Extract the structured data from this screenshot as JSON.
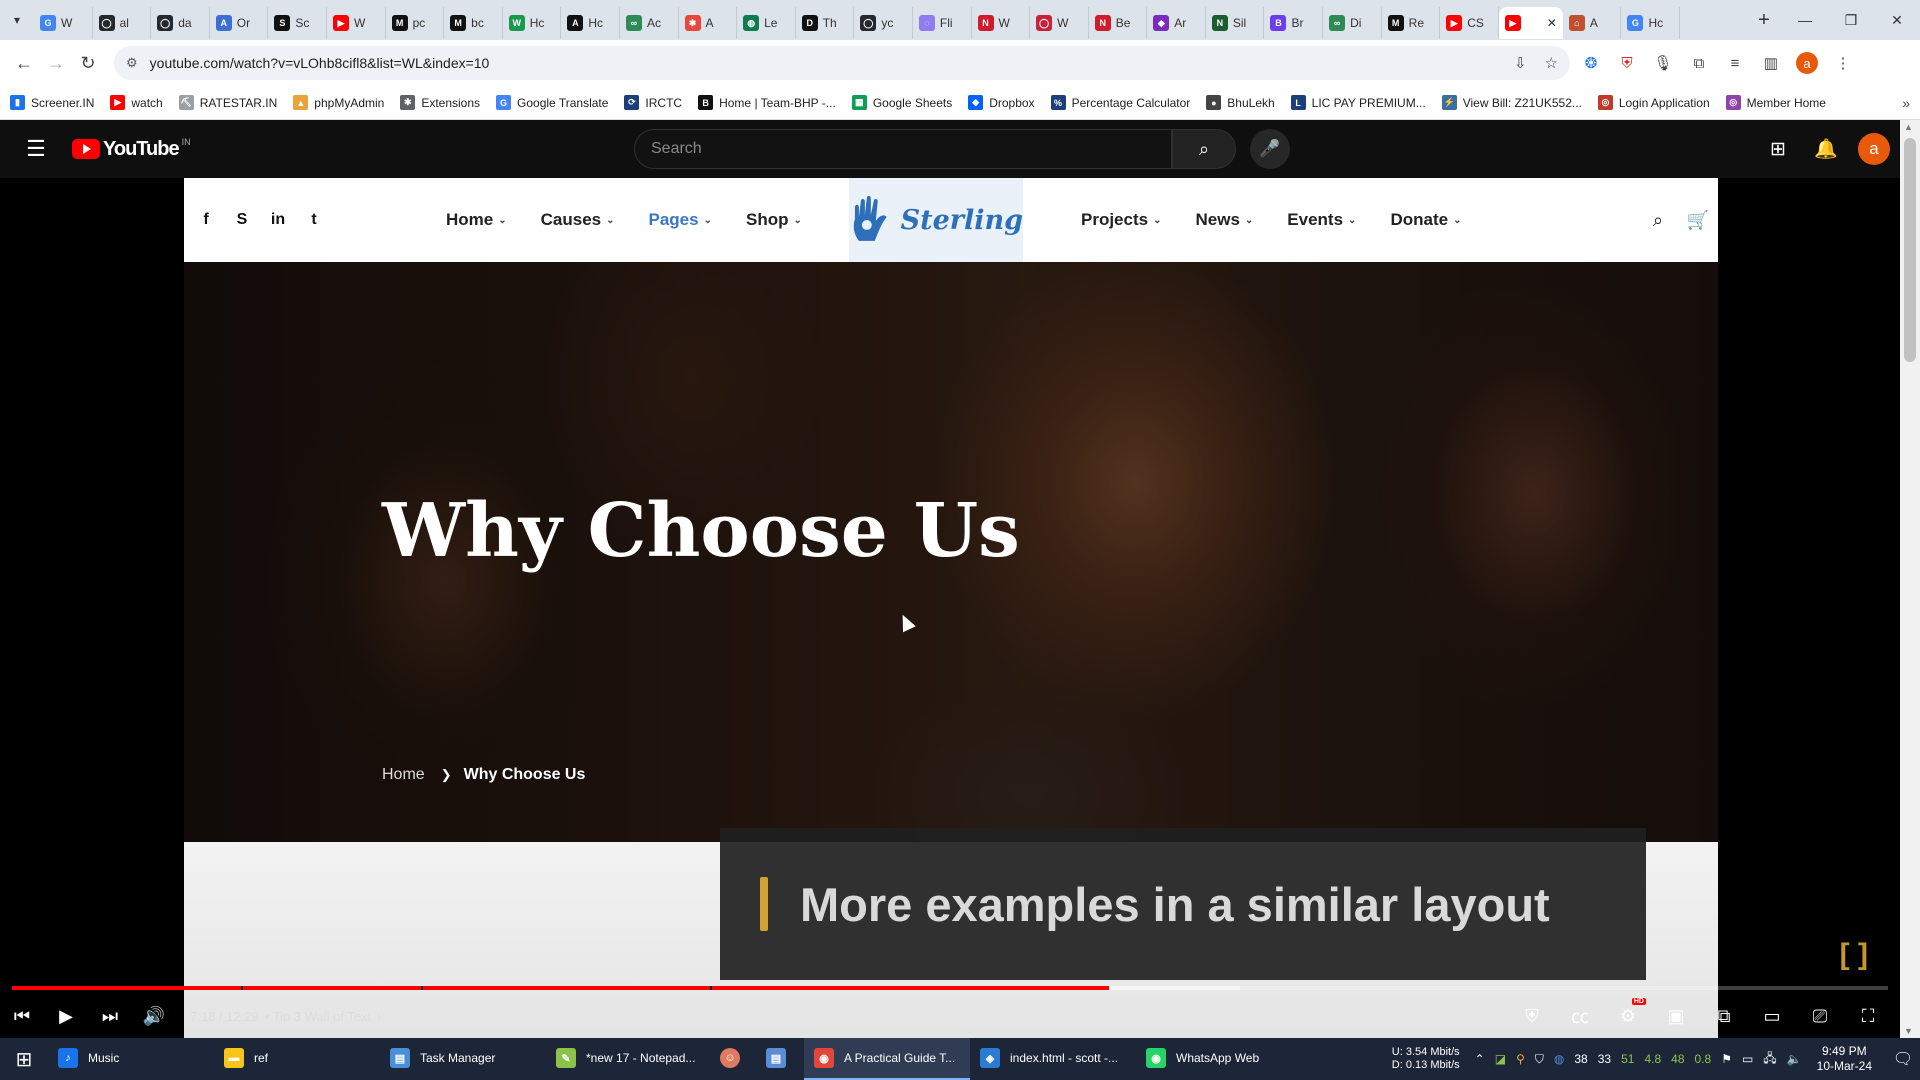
{
  "browser": {
    "tabs": [
      {
        "label": "W",
        "color": "#4285f4",
        "glyph": "G"
      },
      {
        "label": "al",
        "color": "#24292f",
        "glyph": "◯"
      },
      {
        "label": "da",
        "color": "#24292f",
        "glyph": "◯"
      },
      {
        "label": "Or",
        "color": "#3d6fd1",
        "glyph": "A"
      },
      {
        "label": "Sc",
        "color": "#111111",
        "glyph": "S"
      },
      {
        "label": "W",
        "color": "#ff0000",
        "glyph": "▶"
      },
      {
        "label": "pc",
        "color": "#111111",
        "glyph": "M"
      },
      {
        "label": "bc",
        "color": "#111111",
        "glyph": "M"
      },
      {
        "label": "Hc",
        "color": "#1a9b4b",
        "glyph": "W"
      },
      {
        "label": "Hc",
        "color": "#111111",
        "glyph": "A"
      },
      {
        "label": "Ac",
        "color": "#2e8b57",
        "glyph": "∞"
      },
      {
        "label": "A",
        "color": "#e8473c",
        "glyph": "✱"
      },
      {
        "label": "Le",
        "color": "#0f7b4f",
        "glyph": "◍"
      },
      {
        "label": "Th",
        "color": "#111111",
        "glyph": "D"
      },
      {
        "label": "yc",
        "color": "#24292f",
        "glyph": "◯"
      },
      {
        "label": "Fli",
        "color": "#8e7cf0",
        "glyph": "◌"
      },
      {
        "label": "W",
        "color": "#d11a2a",
        "glyph": "N"
      },
      {
        "label": "W",
        "color": "#c8213b",
        "glyph": "◯"
      },
      {
        "label": "Be",
        "color": "#d11a2a",
        "glyph": "N"
      },
      {
        "label": "Ar",
        "color": "#7b2cbf",
        "glyph": "◆"
      },
      {
        "label": "Sil",
        "color": "#1a5c2e",
        "glyph": "N"
      },
      {
        "label": "Br",
        "color": "#6a3df0",
        "glyph": "B"
      },
      {
        "label": "Di",
        "color": "#2e8b57",
        "glyph": "∞"
      },
      {
        "label": "Re",
        "color": "#111111",
        "glyph": "M"
      },
      {
        "label": "CS",
        "color": "#ff0000",
        "glyph": "▶"
      },
      {
        "label": "",
        "color": "#ff0000",
        "glyph": "▶"
      },
      {
        "label": "A",
        "color": "#c1502e",
        "glyph": "⌂"
      },
      {
        "label": "Hc",
        "color": "#4285f4",
        "glyph": "G"
      }
    ],
    "active_tab_index": 25,
    "address": "youtube.com/watch?v=vLOhb8cifl8&list=WL&index=10",
    "bookmarks": [
      {
        "label": "Screener.IN",
        "color": "#1a73e8",
        "glyph": "▮"
      },
      {
        "label": "watch",
        "color": "#ff0000",
        "glyph": "▶"
      },
      {
        "label": "RATESTAR.IN",
        "color": "#9aa0a6",
        "glyph": "⛏"
      },
      {
        "label": "phpMyAdmin",
        "color": "#e8a33c",
        "glyph": "▲"
      },
      {
        "label": "Extensions",
        "color": "#5f6368",
        "glyph": "✱"
      },
      {
        "label": "Google Translate",
        "color": "#4285f4",
        "glyph": "G"
      },
      {
        "label": "IRCTC",
        "color": "#1a3f7a",
        "glyph": "⟳"
      },
      {
        "label": "Home | Team-BHP -...",
        "color": "#111111",
        "glyph": "B"
      },
      {
        "label": "Google Sheets",
        "color": "#0f9d58",
        "glyph": "▦"
      },
      {
        "label": "Dropbox",
        "color": "#0061fe",
        "glyph": "◆"
      },
      {
        "label": "Percentage Calculator",
        "color": "#1a3f7a",
        "glyph": "%"
      },
      {
        "label": "BhuLekh",
        "color": "#444444",
        "glyph": "●"
      },
      {
        "label": "LIC PAY PREMIUM...",
        "color": "#1a3f7a",
        "glyph": "L"
      },
      {
        "label": "View Bill: Z21UK552...",
        "color": "#3a6ea5",
        "glyph": "⚡"
      },
      {
        "label": "Login Application",
        "color": "#c0392b",
        "glyph": "◎"
      },
      {
        "label": "Member Home",
        "color": "#8e44ad",
        "glyph": "◎"
      }
    ]
  },
  "youtube": {
    "logo_text": "YouTube",
    "region": "IN",
    "search_placeholder": "Search",
    "avatar_letter": "a"
  },
  "site": {
    "brand": "Sterling",
    "menu_left": [
      "Home",
      "Causes",
      "Pages",
      "Shop"
    ],
    "menu_right": [
      "Projects",
      "News",
      "Events",
      "Donate"
    ],
    "active_menu": "Pages",
    "social": [
      "f",
      "S",
      "in",
      "t"
    ],
    "hero_title": "Why Choose Us",
    "breadcrumb_home": "Home",
    "breadcrumb_current": "Why Choose Us"
  },
  "video": {
    "caption": "More examples in a similar layout",
    "time_current": "7:18",
    "time_total": "12:29",
    "time_separator": "/",
    "chapter": "• Tip 3 Wall of Text",
    "played_fraction": 0.5846,
    "buffered_fraction": 0.577,
    "chapter_marks": [
      0.122,
      0.218,
      0.372
    ]
  },
  "taskbar": {
    "items": [
      {
        "label": "Music",
        "color": "#1a73e8",
        "glyph": "♪"
      },
      {
        "label": "ref",
        "color": "#f5c518",
        "glyph": "▬"
      },
      {
        "label": "Task Manager",
        "color": "#4a90d9",
        "glyph": "▤"
      },
      {
        "label": "*new 17 - Notepad...",
        "color": "#8bc34a",
        "glyph": "✎"
      }
    ],
    "apps_after": [
      {
        "label": "A Practical Guide T...",
        "color": "#e0473a",
        "glyph": "◉"
      },
      {
        "label": "index.html - scott -...",
        "color": "#2a7bd3",
        "glyph": "◈"
      },
      {
        "label": "WhatsApp Web",
        "color": "#25d366",
        "glyph": "◉"
      }
    ],
    "net_up": "U:",
    "net_up_value": "3.54 Mbit/s",
    "net_down": "D:",
    "net_down_value": "0.13 Mbit/s",
    "tray_numbers": [
      "38",
      "33",
      "51",
      "4.8",
      "48",
      "0.8"
    ],
    "time": "9:49 PM",
    "date": "10-Mar-24"
  }
}
